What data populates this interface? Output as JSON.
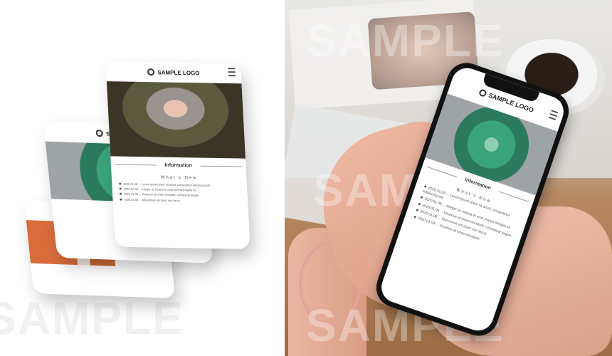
{
  "watermark": "SAMPLE",
  "mockup": {
    "logo": "SAMPLE LOGO",
    "section_title": "Information",
    "news_heading": "What's New",
    "news_items": [
      "2020.01.08 ... Lorem ipsum dolor sit amet, consectetur adipiscing elit.",
      "2020.01.08 ... Integer ac massa et eros viverra fringilla sit.",
      "2020.01.08 ... Vivamus at lorem tincidunt, consequat augue.",
      "2020.01.08 ... Maecenas vel dolor non lacus.",
      "2020.01.08 ... Vivamus at lorem tincidunt."
    ]
  },
  "icons": [
    "logo-circle-icon",
    "hamburger-menu-icon",
    "bullet-icon"
  ]
}
